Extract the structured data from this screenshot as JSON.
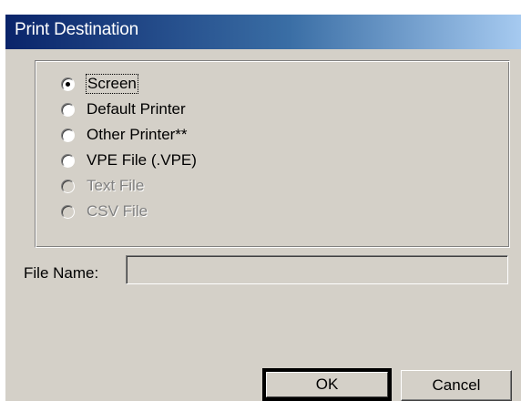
{
  "window": {
    "title": "Print Destination"
  },
  "destination": {
    "options": [
      {
        "label": "Screen",
        "selected": true,
        "enabled": true
      },
      {
        "label": "Default Printer",
        "selected": false,
        "enabled": true
      },
      {
        "label": "Other Printer**",
        "selected": false,
        "enabled": true
      },
      {
        "label": "VPE File (.VPE)",
        "selected": false,
        "enabled": true
      },
      {
        "label": "Text File",
        "selected": false,
        "enabled": false
      },
      {
        "label": "CSV File",
        "selected": false,
        "enabled": false
      }
    ]
  },
  "file_name": {
    "label": "File Name:",
    "value": "",
    "enabled": false
  },
  "buttons": {
    "ok_label": "OK",
    "cancel_label": "Cancel"
  },
  "colors": {
    "title_gradient_start": "#0a246a",
    "title_gradient_end": "#a6caf0",
    "dialog_face": "#d4d0c8",
    "disabled_text": "#808080"
  }
}
